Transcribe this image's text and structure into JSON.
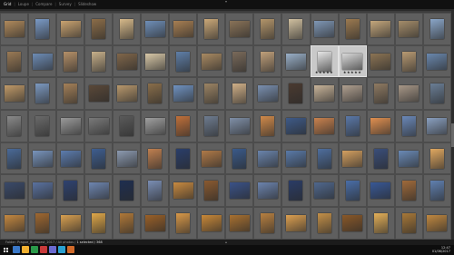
{
  "app": {
    "modules": [
      "Grid",
      "Loupe",
      "Compare",
      "Survey",
      "Slideshow"
    ],
    "active_module": 0
  },
  "status": {
    "path": "Folder: Prague_Budapest_2017",
    "filter": "All photos",
    "selection": "1 selected / 368"
  },
  "taskbar": {
    "time": "12:47",
    "date": "01/06/2017"
  },
  "grid": {
    "columns": 16,
    "rows": 7,
    "selected_index": [
      27,
      28
    ],
    "row_palettes": [
      [
        "#b08a5c",
        "#7a9ac6",
        "#c9a370",
        "#8c6d48",
        "#d6b98a",
        "#6f8fb8",
        "#a87f52",
        "#caa878",
        "#8a7358",
        "#b3956a",
        "#d0c0a0",
        "#7f97b5",
        "#9c7a50",
        "#c4a77c",
        "#a58d6a",
        "#8aa6c8"
      ],
      [
        "#9a7a55",
        "#6d8cb5",
        "#b59068",
        "#c7b08a",
        "#80664a",
        "#d8c8a8",
        "#5f7fa8",
        "#a98a62",
        "#7a6a5a",
        "#c0a07a",
        "#9ab0c8",
        "#e6e6e6",
        "#d8d8d8",
        "#8c7454",
        "#b89a72",
        "#6a88ae"
      ],
      [
        "#c09a68",
        "#7c99c0",
        "#a48058",
        "#5a4838",
        "#b8986c",
        "#8a6e4a",
        "#6f92c0",
        "#9c8464",
        "#d0b088",
        "#7a90b0",
        "#4a3a30",
        "#c8b49a",
        "#b0a090",
        "#8f7a62",
        "#a89888",
        "#6a7e96"
      ],
      [
        "#8a8a8a",
        "#6a6a6a",
        "#9a9a9a",
        "#7a7a7a",
        "#5a5a5a",
        "#a0a0a0",
        "#c0703a",
        "#6e7c90",
        "#8090a8",
        "#d08a4a",
        "#3e5a88",
        "#c9824e",
        "#5a78a8",
        "#e09050",
        "#6a88b8",
        "#8aa0c0"
      ],
      [
        "#4a6a98",
        "#7894bc",
        "#5c7cae",
        "#3e5e90",
        "#8c9ab0",
        "#c08050",
        "#2a3e6a",
        "#b07a48",
        "#3a5a8a",
        "#6a84ac",
        "#5a7aa8",
        "#4e6e9e",
        "#d4a060",
        "#3a4e7a",
        "#6a8ab6",
        "#e0a860"
      ],
      [
        "#3a4a6a",
        "#5a72a0",
        "#2e4270",
        "#6e86b0",
        "#1e2e50",
        "#7a8eb4",
        "#c88a40",
        "#8a5a30",
        "#3a5288",
        "#6c84ae",
        "#2a3c66",
        "#50688e",
        "#4a6ea8",
        "#385896",
        "#a06a3a",
        "#6080b0"
      ],
      [
        "#c48840",
        "#a06830",
        "#d8a050",
        "#e0a848",
        "#b07838",
        "#9a6028",
        "#d89848",
        "#c88838",
        "#a87030",
        "#b88040",
        "#dca050",
        "#c49048",
        "#8a5828",
        "#e4b058",
        "#a87838",
        "#c08840"
      ]
    ],
    "portrait_pattern": [
      0,
      1,
      0,
      1,
      1,
      0,
      0,
      1,
      0,
      1,
      1,
      0,
      1,
      0,
      0,
      1
    ],
    "stars_label": "★★★★★"
  }
}
